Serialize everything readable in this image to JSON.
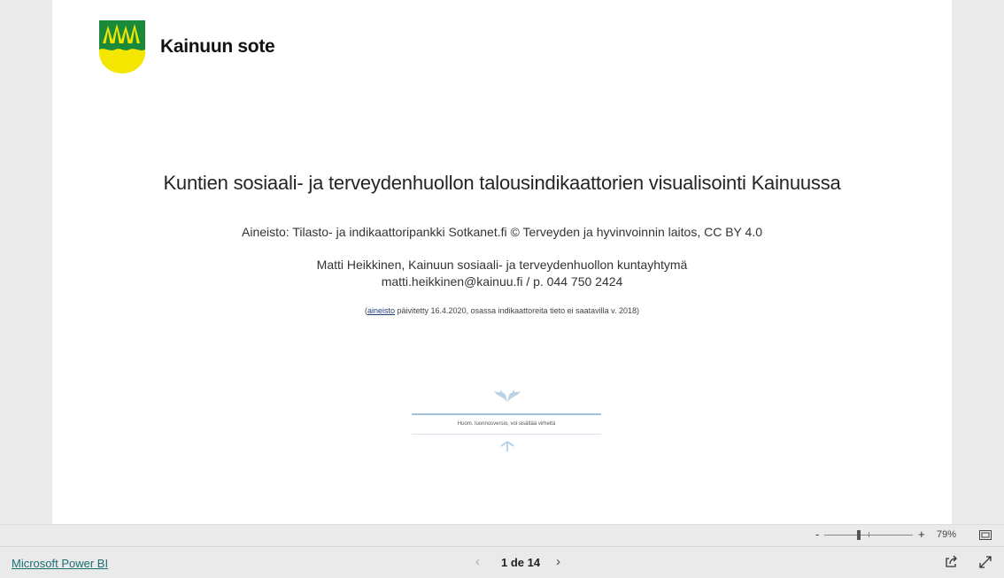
{
  "report": {
    "logo_text": "Kainuun sote",
    "title": "Kuntien sosiaali- ja terveydenhuollon talousindikaattorien visualisointi Kainuussa",
    "source": "Aineisto: Tilasto- ja indikaattoripankki Sotkanet.fi © Terveyden ja hyvinvoinnin laitos,  CC BY 4.0",
    "author": "Matti Heikkinen, Kainuun sosiaali- ja terveydenhuollon kuntayhtymä",
    "contact": "matti.heikkinen@kainuu.fi / p. 044 750 2424",
    "note_open": "(",
    "note_link": "aineisto",
    "note_rest": " päivitetty 16.4.2020, osassa indikaattoreita tieto ei saatavilla v. 2018)",
    "deco_text": "Huom. luonnosversio, voi sisältää virheitä"
  },
  "zoombar": {
    "minus": "-",
    "plus": "+",
    "zoom_label": "79%",
    "zoom_percent": 79
  },
  "footer": {
    "brand": "Microsoft Power BI",
    "page_info": "1 de 14",
    "prev_icon": "chevron-left-icon",
    "next_icon": "chevron-right-icon"
  },
  "colors": {
    "logo_green": "#1a8a3a",
    "logo_yellow": "#f3e600",
    "brand_link": "#1c6f73"
  }
}
